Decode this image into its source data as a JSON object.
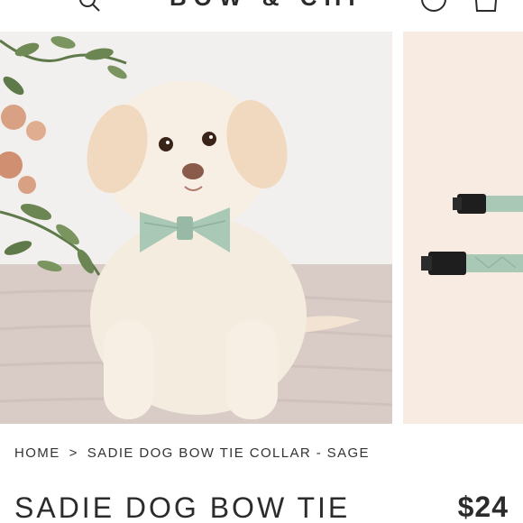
{
  "header": {
    "logo_text": "BOW & CHIEF",
    "search_icon": "search-icon",
    "account_icon": "account-icon",
    "cart_icon": "cart-icon"
  },
  "gallery": {
    "main_image_alt": "Dog wearing sage bow tie collar",
    "side_image_alt": "Sage collar buckles"
  },
  "breadcrumb": {
    "home": "HOME",
    "separator": ">",
    "current": "SADIE DOG BOW TIE COLLAR - SAGE"
  },
  "product": {
    "title": "SADIE DOG BOW TIE",
    "price": "$24"
  },
  "colors": {
    "sage": "#a9c8b6",
    "blush_bg": "#f7ebe2"
  }
}
